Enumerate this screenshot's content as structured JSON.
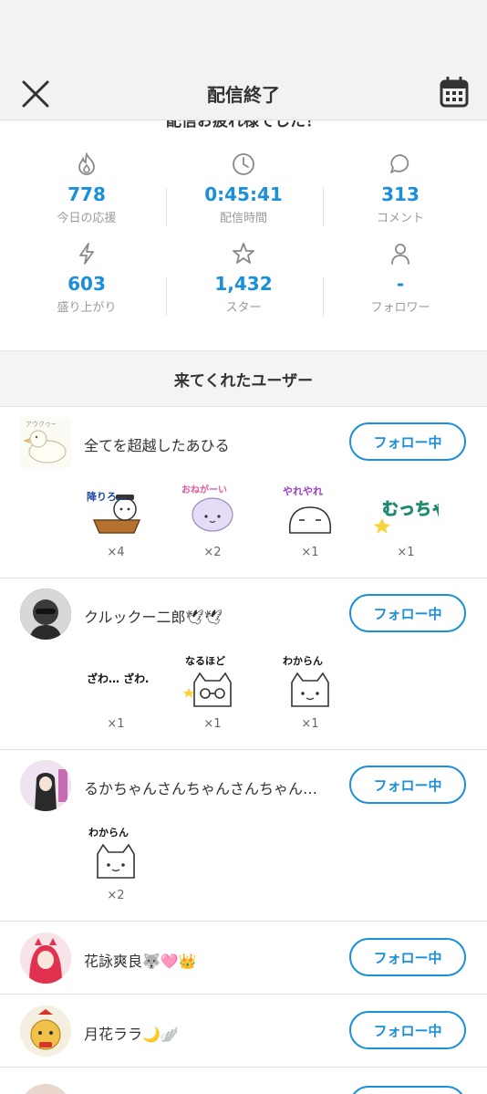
{
  "header": {
    "title": "配信終了"
  },
  "summary": {
    "heading": "配信お疲れ様でした！"
  },
  "stats": [
    {
      "value": "778",
      "label": "今日の応援",
      "icon": "flame-icon"
    },
    {
      "value": "0:45:41",
      "label": "配信時間",
      "icon": "clock-icon"
    },
    {
      "value": "313",
      "label": "コメント",
      "icon": "comment-icon"
    },
    {
      "value": "603",
      "label": "盛り上がり",
      "icon": "lightning-icon"
    },
    {
      "value": "1,432",
      "label": "スター",
      "icon": "star-icon"
    },
    {
      "value": "-",
      "label": "フォロワー",
      "icon": "person-icon"
    }
  ],
  "visitors": {
    "heading": "来てくれたユーザー",
    "follow_label": "フォロー中",
    "users": [
      {
        "name": "全てを超越したあひる",
        "stamps": [
          {
            "text": "降りろ…",
            "count": "×4"
          },
          {
            "text": "おねがーい",
            "count": "×2"
          },
          {
            "text": "やれやれ",
            "count": "×1"
          },
          {
            "text": "むっちゃ",
            "count": "×1"
          }
        ]
      },
      {
        "name": "クルックー二郎🕊🕊",
        "stamps": [
          {
            "text": "ざわ… ざわ…",
            "count": "×1"
          },
          {
            "text": "なるほど",
            "count": "×1"
          },
          {
            "text": "わからん",
            "count": "×1"
          }
        ]
      },
      {
        "name": "るかちゃんさんちゃんさんちゃん…",
        "stamps": [
          {
            "text": "わからん",
            "count": "×2"
          }
        ]
      },
      {
        "name": "花詠爽良🐺🩷👑",
        "stamps": []
      },
      {
        "name": "月花ララ🌙🪽",
        "stamps": []
      }
    ]
  },
  "colors": {
    "accent": "#1a8fdb",
    "label": "#9a9a9a",
    "background": "#f2f2f2"
  }
}
